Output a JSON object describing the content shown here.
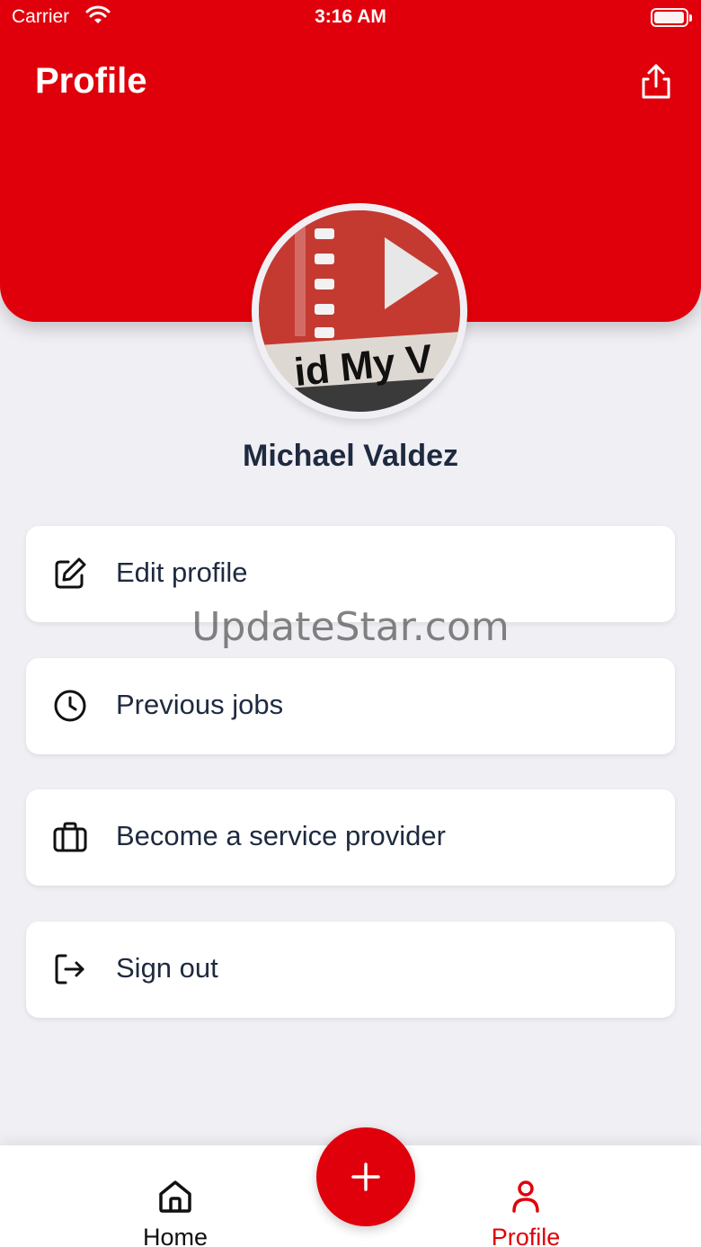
{
  "status_bar": {
    "carrier": "Carrier",
    "time": "3:16 AM"
  },
  "header": {
    "title": "Profile",
    "share_icon": "share-icon"
  },
  "profile": {
    "name": "Michael Valdez",
    "avatar_text": "id My V"
  },
  "menu": [
    {
      "label": "Edit profile",
      "icon": "edit-icon"
    },
    {
      "label": "Previous jobs",
      "icon": "clock-icon"
    },
    {
      "label": "Become a service provider",
      "icon": "briefcase-icon"
    },
    {
      "label": "Sign out",
      "icon": "sign-out-icon"
    }
  ],
  "watermark": "UpdateStar.com",
  "tabbar": {
    "home_label": "Home",
    "profile_label": "Profile",
    "fab_icon": "plus-icon"
  },
  "colors": {
    "accent": "#e0000b",
    "background": "#f0eff4",
    "text": "#1e2a3f"
  }
}
